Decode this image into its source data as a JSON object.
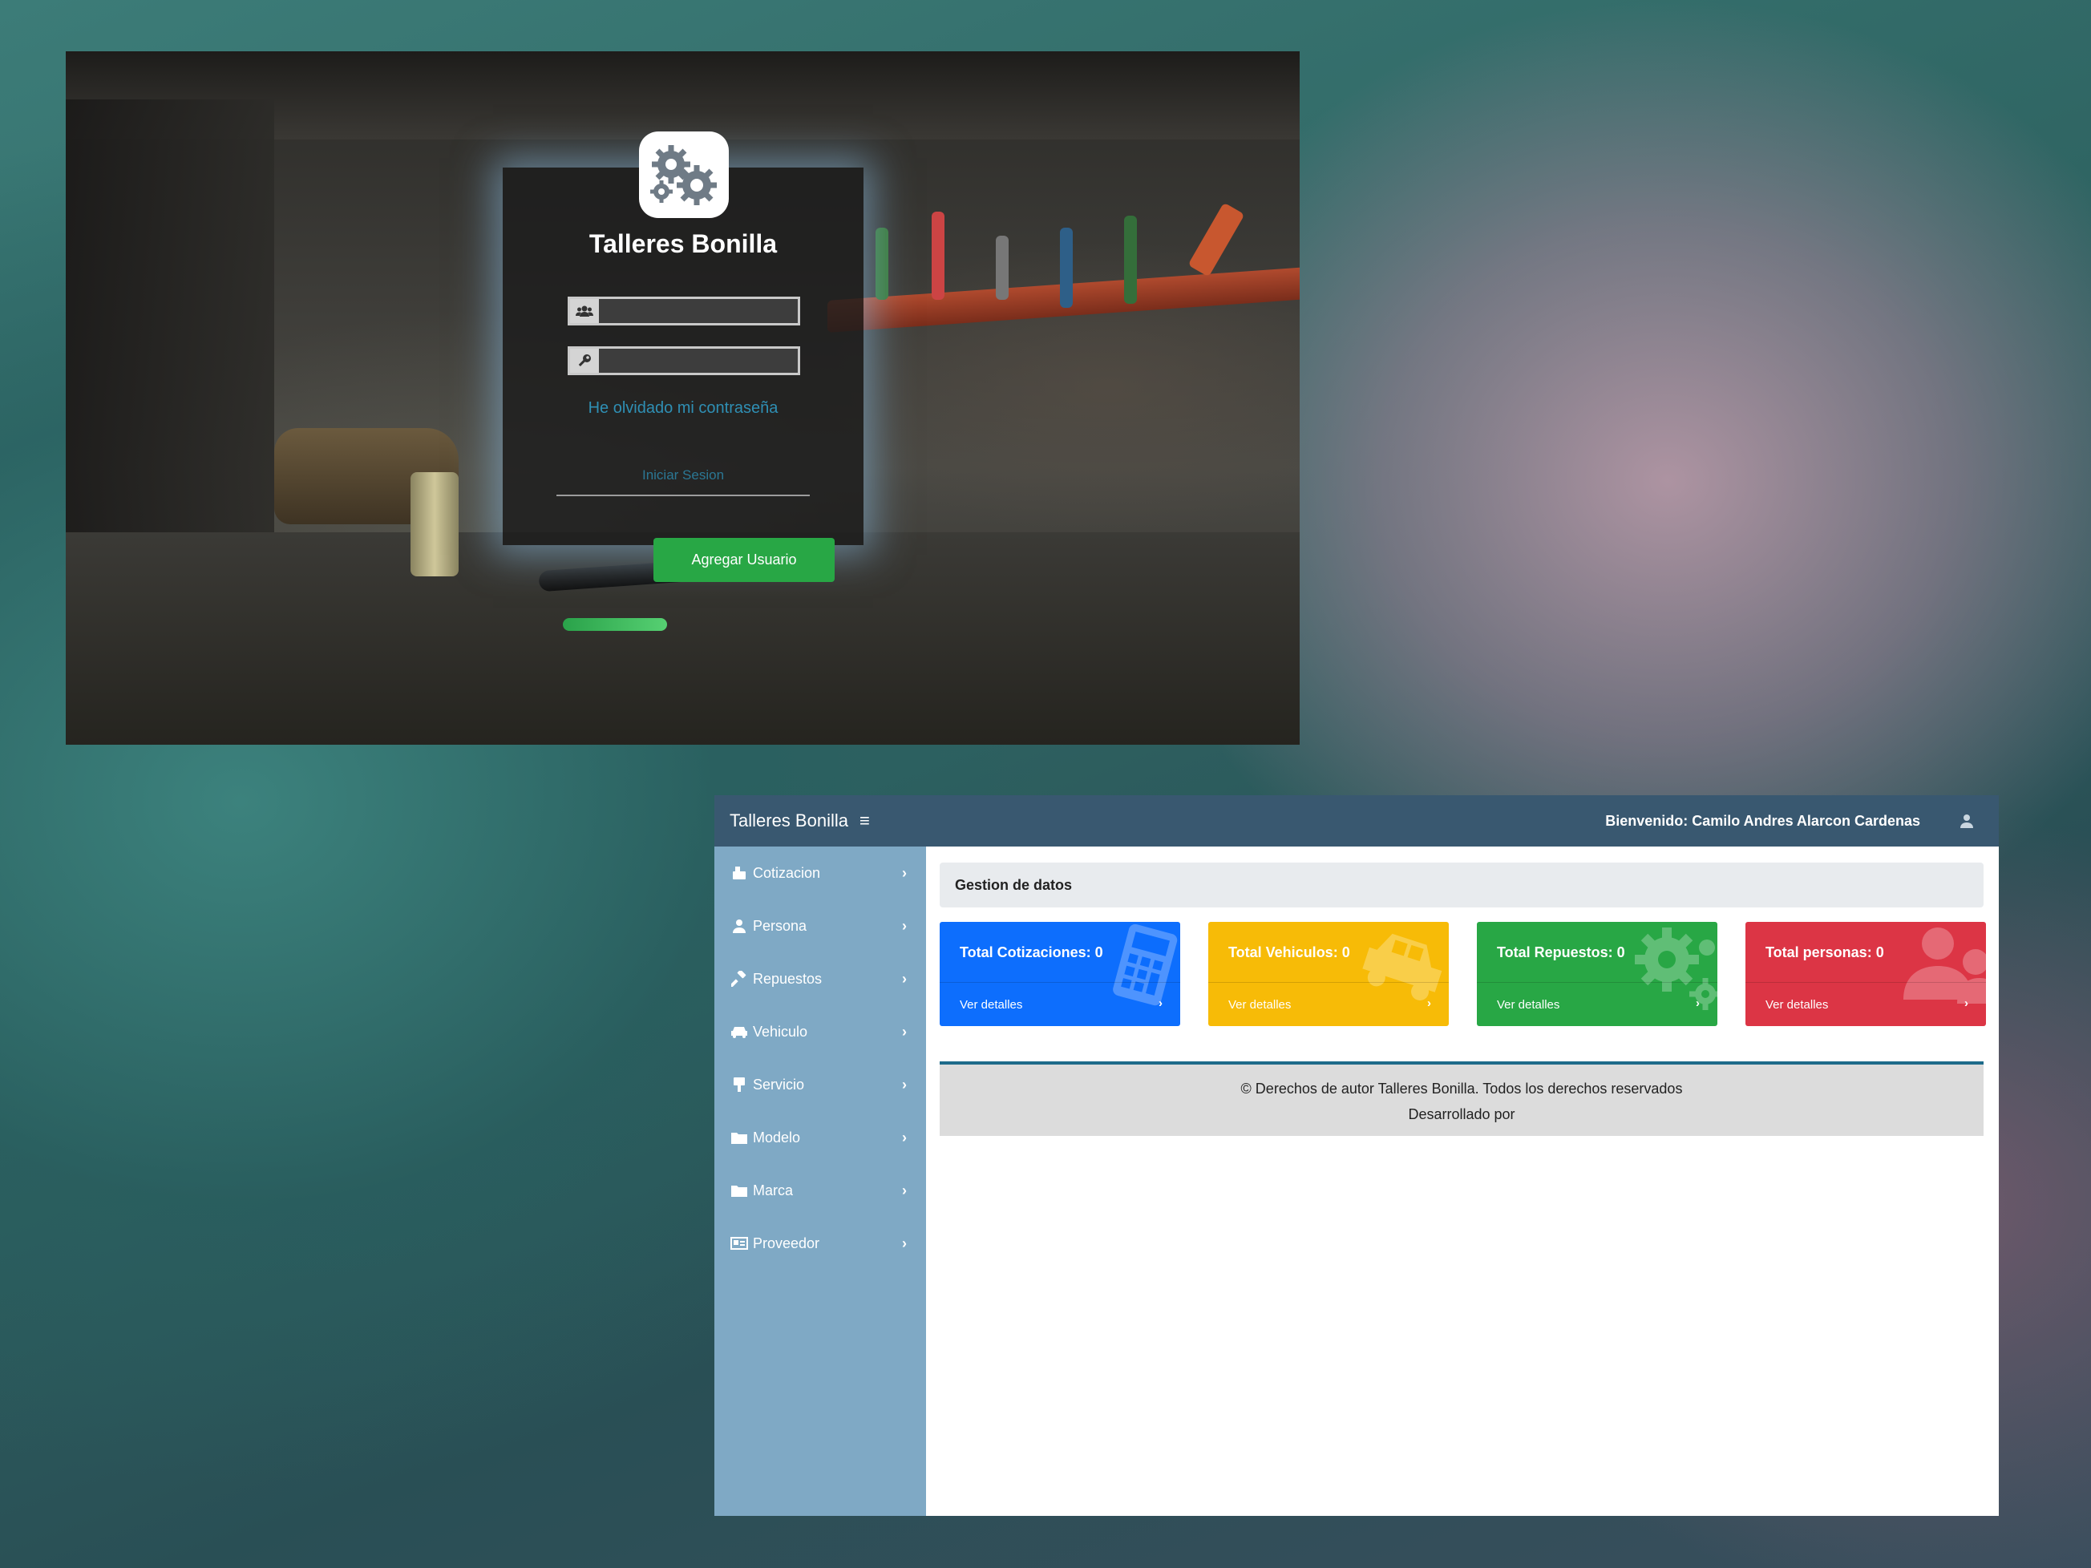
{
  "login": {
    "title": "Talleres Bonilla",
    "username_placeholder": "",
    "password_placeholder": "",
    "forgot_password": "He olvidado mi contraseña",
    "login_button": "Iniciar Sesion",
    "add_user_button": "Agregar Usuario",
    "icons": {
      "logo": "gears-icon",
      "username": "users-icon",
      "password": "key-icon"
    }
  },
  "dashboard": {
    "topbar": {
      "brand": "Talleres Bonilla",
      "menu_icon": "≡",
      "welcome": "Bienvenido: Camilo Andres Alarcon Cardenas",
      "user_icon": "user-icon"
    },
    "sidebar": {
      "items": [
        {
          "label": "Cotizacion",
          "icon": "cotizacion-icon"
        },
        {
          "label": "Persona",
          "icon": "person-icon"
        },
        {
          "label": "Repuestos",
          "icon": "hammer-icon"
        },
        {
          "label": "Vehiculo",
          "icon": "car-icon"
        },
        {
          "label": "Servicio",
          "icon": "servicio-icon"
        },
        {
          "label": "Modelo",
          "icon": "folder-icon"
        },
        {
          "label": "Marca",
          "icon": "folder-icon"
        },
        {
          "label": "Proveedor",
          "icon": "id-card-icon"
        }
      ],
      "chevron": "›"
    },
    "section_title": "Gestion de datos",
    "cards": [
      {
        "total": "Total Cotizaciones: 0",
        "details": "Ver detalles",
        "color": "#0d6efd",
        "icon": "calculator-icon"
      },
      {
        "total": "Total Vehiculos: 0",
        "details": "Ver detalles",
        "color": "#f7bb07",
        "icon": "car-icon"
      },
      {
        "total": "Total Repuestos: 0",
        "details": "Ver detalles",
        "color": "#28a745",
        "icon": "gears-icon"
      },
      {
        "total": "Total personas: 0",
        "details": "Ver detalles",
        "color": "#dc3545",
        "icon": "users-icon"
      }
    ],
    "card_arrow": "›",
    "footer": {
      "line1": "© Derechos de autor Talleres Bonilla. Todos los derechos reservados",
      "line2": "Desarrollado por"
    }
  },
  "colors": {
    "topbar": "#395870",
    "sidebar": "#7fa9c5",
    "footer_border": "#1e6b8a",
    "link": "#2f8fb4"
  }
}
